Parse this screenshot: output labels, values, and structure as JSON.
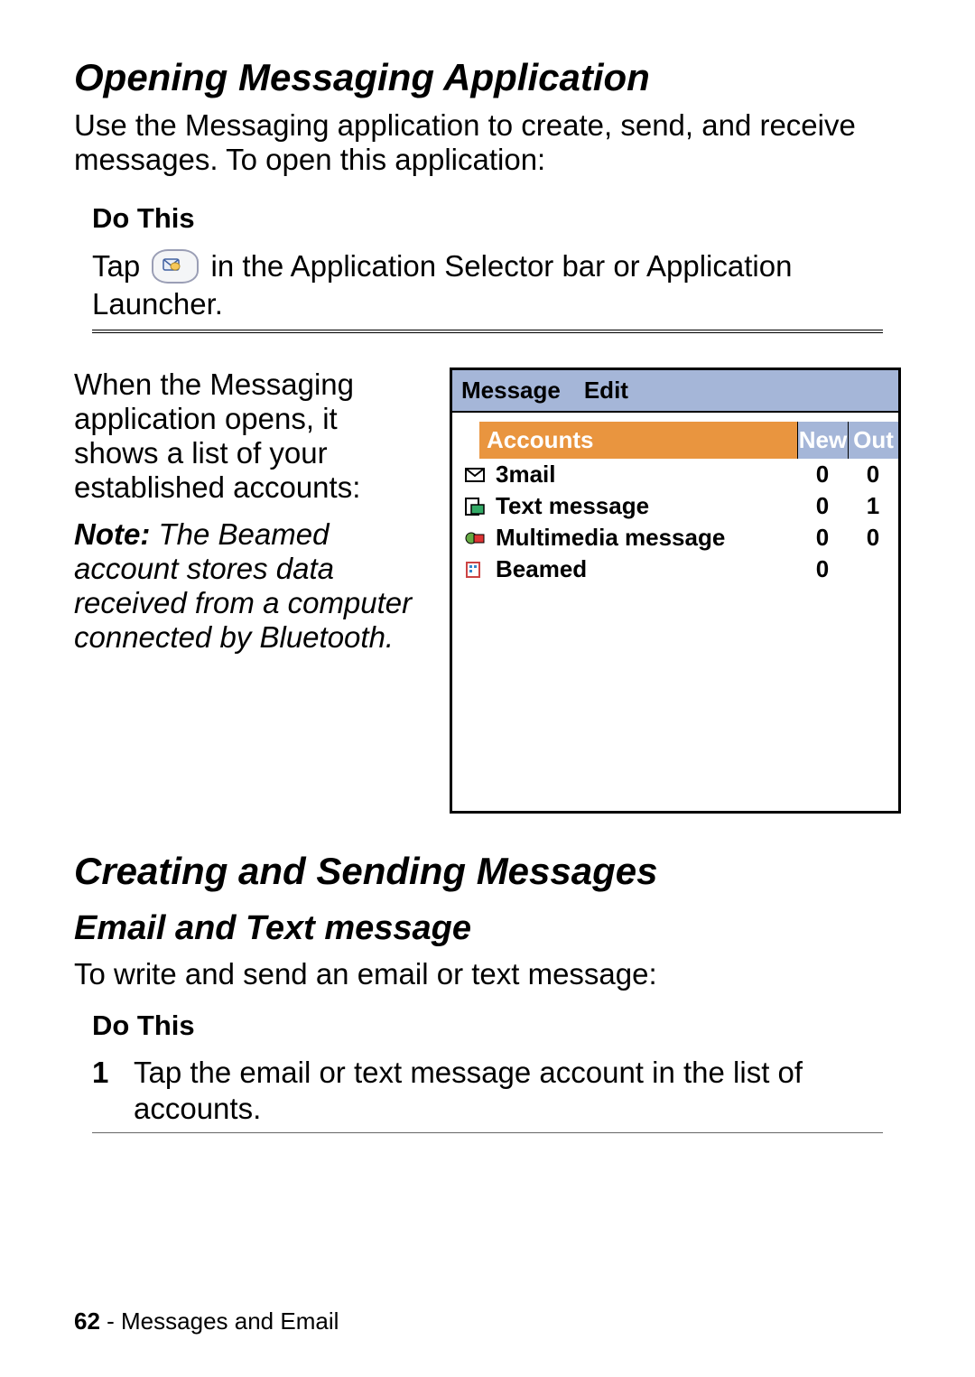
{
  "section1": {
    "title": "Opening Messaging Application",
    "intro": "Use the Messaging application to create, send, and receive messages. To open this application:",
    "doThis": "Do This",
    "tap_before": "Tap ",
    "tap_after": " in the Application Selector bar or Application Launcher."
  },
  "midtext": {
    "para": "When the Messaging application opens, it shows a list of your established accounts:",
    "note_label": "Note:",
    "note_body": " The Beamed account stores data received from a computer connected by Bluetooth."
  },
  "phone": {
    "menu": {
      "message": "Message",
      "edit": "Edit"
    },
    "header": {
      "accounts": "Accounts",
      "new": "New",
      "out": "Out"
    },
    "rows": [
      {
        "label": "3mail",
        "new": "0",
        "out": "0"
      },
      {
        "label": "Text message",
        "new": "0",
        "out": "1"
      },
      {
        "label": "Multimedia message",
        "new": "0",
        "out": "0"
      },
      {
        "label": "Beamed",
        "new": "0",
        "out": ""
      }
    ]
  },
  "section2": {
    "title": "Creating and Sending Messages",
    "subtitle": "Email and Text message",
    "intro": "To write and send an email or text message:",
    "doThis": "Do This",
    "step1_num": "1",
    "step1": "Tap the email or text message account in the list of accounts."
  },
  "footer": {
    "page": "62",
    "chapter": " - Messages and Email"
  }
}
